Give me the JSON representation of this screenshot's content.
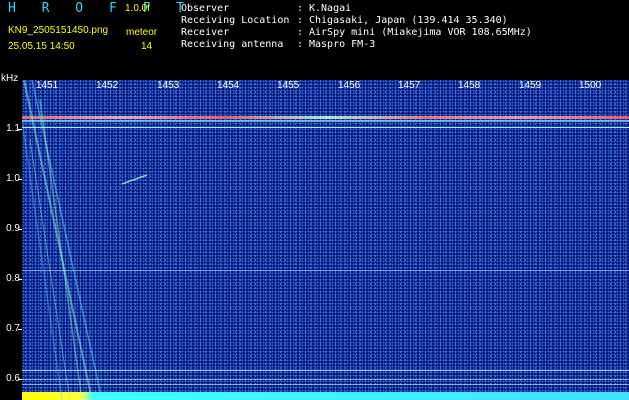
{
  "app": {
    "title": "H R O F F T",
    "version": "1.0.0f",
    "filename": "KN9_2505151450.png",
    "mode": "meteor",
    "datetime": "25.05.15 14:50",
    "count": "14"
  },
  "info": [
    {
      "key": "Observer",
      "value": "K.Nagai"
    },
    {
      "key": "Receiving Location",
      "value": "Chigasaki, Japan (139.414 35.340)"
    },
    {
      "key": "Receiver",
      "value": "AirSpy mini (Miakejima VOR 108.65MHz)"
    },
    {
      "key": "Receiving antenna",
      "value": "Maspro FM-3"
    }
  ],
  "axes": {
    "y_unit": "kHz",
    "y_labels": [
      "1.1",
      "1.0",
      "0.9",
      "0.8",
      "0.7",
      "0.6"
    ],
    "x_labels": [
      "1451",
      "1452",
      "1453",
      "1454",
      "1455",
      "1456",
      "1457",
      "1458",
      "1459",
      "1500"
    ]
  },
  "colors": {
    "background": "#06187a",
    "carrier": "#ff7060",
    "line": "#80e0ff",
    "bottom_band": "#ffff00"
  }
}
